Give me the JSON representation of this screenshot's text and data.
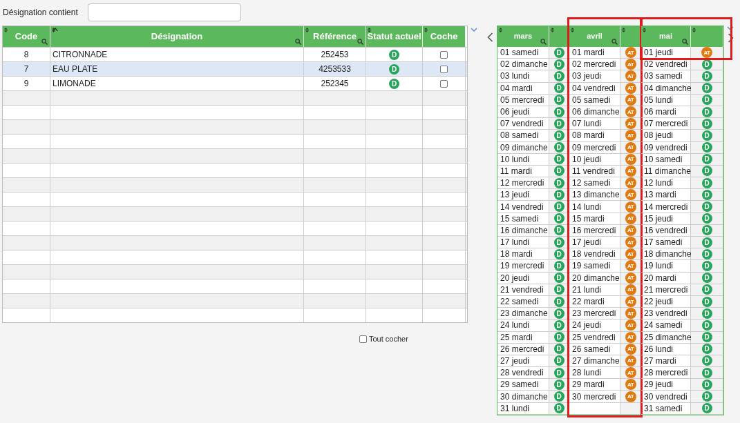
{
  "filter": {
    "label": "Désignation contient"
  },
  "products": {
    "columns": [
      {
        "label": "Code",
        "searchable": true,
        "sorted": false
      },
      {
        "label": "Désignation",
        "searchable": true,
        "sorted": true
      },
      {
        "label": "Référence",
        "searchable": true,
        "sorted": false
      },
      {
        "label": "Statut actuel",
        "searchable": false,
        "sorted": false
      },
      {
        "label": "Coche",
        "searchable": false,
        "sorted": false
      }
    ],
    "rows": [
      {
        "code": "8",
        "designation": "CITRONNADE",
        "reference": "252453",
        "status": "D",
        "color": "#27a55a",
        "checked": false,
        "selected": false
      },
      {
        "code": "7",
        "designation": "EAU PLATE",
        "reference": "4253533",
        "status": "D",
        "color": "#27a55a",
        "checked": false,
        "selected": true
      },
      {
        "code": "9",
        "designation": "LIMONADE",
        "reference": "252345",
        "status": "D",
        "color": "#27a55a",
        "checked": false,
        "selected": false
      }
    ]
  },
  "check_all": {
    "label": "Tout cocher",
    "checked": false
  },
  "calendar": {
    "months": [
      {
        "name": "mars",
        "days": [
          {
            "day": "01 samedi",
            "badge": "D",
            "color": "#27a55a"
          },
          {
            "day": "02 dimanche",
            "badge": "D",
            "color": "#27a55a"
          },
          {
            "day": "03 lundi",
            "badge": "D",
            "color": "#27a55a"
          },
          {
            "day": "04 mardi",
            "badge": "D",
            "color": "#27a55a"
          },
          {
            "day": "05 mercredi",
            "badge": "D",
            "color": "#27a55a"
          },
          {
            "day": "06 jeudi",
            "badge": "D",
            "color": "#27a55a"
          },
          {
            "day": "07 vendredi",
            "badge": "D",
            "color": "#27a55a"
          },
          {
            "day": "08 samedi",
            "badge": "D",
            "color": "#27a55a"
          },
          {
            "day": "09 dimanche",
            "badge": "D",
            "color": "#27a55a"
          },
          {
            "day": "10 lundi",
            "badge": "D",
            "color": "#27a55a"
          },
          {
            "day": "11 mardi",
            "badge": "D",
            "color": "#27a55a"
          },
          {
            "day": "12 mercredi",
            "badge": "D",
            "color": "#27a55a"
          },
          {
            "day": "13 jeudi",
            "badge": "D",
            "color": "#27a55a"
          },
          {
            "day": "14 vendredi",
            "badge": "D",
            "color": "#27a55a"
          },
          {
            "day": "15 samedi",
            "badge": "D",
            "color": "#27a55a"
          },
          {
            "day": "16 dimanche",
            "badge": "D",
            "color": "#27a55a"
          },
          {
            "day": "17 lundi",
            "badge": "D",
            "color": "#27a55a"
          },
          {
            "day": "18 mardi",
            "badge": "D",
            "color": "#27a55a"
          },
          {
            "day": "19 mercredi",
            "badge": "D",
            "color": "#27a55a"
          },
          {
            "day": "20 jeudi",
            "badge": "D",
            "color": "#27a55a"
          },
          {
            "day": "21 vendredi",
            "badge": "D",
            "color": "#27a55a"
          },
          {
            "day": "22 samedi",
            "badge": "D",
            "color": "#27a55a"
          },
          {
            "day": "23 dimanche",
            "badge": "D",
            "color": "#27a55a"
          },
          {
            "day": "24 lundi",
            "badge": "D",
            "color": "#27a55a"
          },
          {
            "day": "25 mardi",
            "badge": "D",
            "color": "#27a55a"
          },
          {
            "day": "26 mercredi",
            "badge": "D",
            "color": "#27a55a"
          },
          {
            "day": "27 jeudi",
            "badge": "D",
            "color": "#27a55a"
          },
          {
            "day": "28 vendredi",
            "badge": "D",
            "color": "#27a55a"
          },
          {
            "day": "29 samedi",
            "badge": "D",
            "color": "#27a55a"
          },
          {
            "day": "30 dimanche",
            "badge": "D",
            "color": "#27a55a"
          },
          {
            "day": "31 lundi",
            "badge": "D",
            "color": "#27a55a"
          }
        ]
      },
      {
        "name": "avril",
        "column_framed": true,
        "days": [
          {
            "day": "01 mardi",
            "badge": "AT",
            "color": "#df7a12"
          },
          {
            "day": "02 mercredi",
            "badge": "AT",
            "color": "#df7a12"
          },
          {
            "day": "03 jeudi",
            "badge": "AT",
            "color": "#df7a12"
          },
          {
            "day": "04 vendredi",
            "badge": "AT",
            "color": "#df7a12"
          },
          {
            "day": "05 samedi",
            "badge": "AT",
            "color": "#df7a12"
          },
          {
            "day": "06 dimanche",
            "badge": "AT",
            "color": "#df7a12"
          },
          {
            "day": "07 lundi",
            "badge": "AT",
            "color": "#df7a12"
          },
          {
            "day": "08 mardi",
            "badge": "AT",
            "color": "#df7a12"
          },
          {
            "day": "09 mercredi",
            "badge": "AT",
            "color": "#df7a12"
          },
          {
            "day": "10 jeudi",
            "badge": "AT",
            "color": "#df7a12"
          },
          {
            "day": "11 vendredi",
            "badge": "AT",
            "color": "#df7a12"
          },
          {
            "day": "12 samedi",
            "badge": "AT",
            "color": "#df7a12"
          },
          {
            "day": "13 dimanche",
            "badge": "AT",
            "color": "#df7a12"
          },
          {
            "day": "14 lundi",
            "badge": "AT",
            "color": "#df7a12"
          },
          {
            "day": "15 mardi",
            "badge": "AT",
            "color": "#df7a12"
          },
          {
            "day": "16 mercredi",
            "badge": "AT",
            "color": "#df7a12"
          },
          {
            "day": "17 jeudi",
            "badge": "AT",
            "color": "#df7a12"
          },
          {
            "day": "18 vendredi",
            "badge": "AT",
            "color": "#df7a12"
          },
          {
            "day": "19 samedi",
            "badge": "AT",
            "color": "#df7a12"
          },
          {
            "day": "20 dimanche",
            "badge": "AT",
            "color": "#df7a12"
          },
          {
            "day": "21 lundi",
            "badge": "AT",
            "color": "#df7a12"
          },
          {
            "day": "22 mardi",
            "badge": "AT",
            "color": "#df7a12"
          },
          {
            "day": "23 mercredi",
            "badge": "AT",
            "color": "#df7a12"
          },
          {
            "day": "24 jeudi",
            "badge": "AT",
            "color": "#df7a12"
          },
          {
            "day": "25 vendredi",
            "badge": "AT",
            "color": "#df7a12"
          },
          {
            "day": "26 samedi",
            "badge": "AT",
            "color": "#df7a12"
          },
          {
            "day": "27 dimanche",
            "badge": "AT",
            "color": "#df7a12"
          },
          {
            "day": "28 lundi",
            "badge": "AT",
            "color": "#df7a12"
          },
          {
            "day": "29 mardi",
            "badge": "AT",
            "color": "#df7a12"
          },
          {
            "day": "30 mercredi",
            "badge": "AT",
            "color": "#df7a12"
          }
        ]
      },
      {
        "name": "mai",
        "first_row_framed": true,
        "days": [
          {
            "day": "01 jeudi",
            "badge": "AT",
            "color": "#df7a12"
          },
          {
            "day": "02 vendredi",
            "badge": "D",
            "color": "#27a55a"
          },
          {
            "day": "03 samedi",
            "badge": "D",
            "color": "#27a55a"
          },
          {
            "day": "04 dimanche",
            "badge": "D",
            "color": "#27a55a"
          },
          {
            "day": "05 lundi",
            "badge": "D",
            "color": "#27a55a"
          },
          {
            "day": "06 mardi",
            "badge": "D",
            "color": "#27a55a"
          },
          {
            "day": "07 mercredi",
            "badge": "D",
            "color": "#27a55a"
          },
          {
            "day": "08 jeudi",
            "badge": "D",
            "color": "#27a55a"
          },
          {
            "day": "09 vendredi",
            "badge": "D",
            "color": "#27a55a"
          },
          {
            "day": "10 samedi",
            "badge": "D",
            "color": "#27a55a"
          },
          {
            "day": "11 dimanche",
            "badge": "D",
            "color": "#27a55a"
          },
          {
            "day": "12 lundi",
            "badge": "D",
            "color": "#27a55a"
          },
          {
            "day": "13 mardi",
            "badge": "D",
            "color": "#27a55a"
          },
          {
            "day": "14 mercredi",
            "badge": "D",
            "color": "#27a55a"
          },
          {
            "day": "15 jeudi",
            "badge": "D",
            "color": "#27a55a"
          },
          {
            "day": "16 vendredi",
            "badge": "D",
            "color": "#27a55a"
          },
          {
            "day": "17 samedi",
            "badge": "D",
            "color": "#27a55a"
          },
          {
            "day": "18 dimanche",
            "badge": "D",
            "color": "#27a55a"
          },
          {
            "day": "19 lundi",
            "badge": "D",
            "color": "#27a55a"
          },
          {
            "day": "20 mardi",
            "badge": "D",
            "color": "#27a55a"
          },
          {
            "day": "21 mercredi",
            "badge": "D",
            "color": "#27a55a"
          },
          {
            "day": "22 jeudi",
            "badge": "D",
            "color": "#27a55a"
          },
          {
            "day": "23 vendredi",
            "badge": "D",
            "color": "#27a55a"
          },
          {
            "day": "24 samedi",
            "badge": "D",
            "color": "#27a55a"
          },
          {
            "day": "25 dimanche",
            "badge": "D",
            "color": "#27a55a"
          },
          {
            "day": "26 lundi",
            "badge": "D",
            "color": "#27a55a"
          },
          {
            "day": "27 mardi",
            "badge": "D",
            "color": "#27a55a"
          },
          {
            "day": "28 mercredi",
            "badge": "D",
            "color": "#27a55a"
          },
          {
            "day": "29 jeudi",
            "badge": "D",
            "color": "#27a55a"
          },
          {
            "day": "30 vendredi",
            "badge": "D",
            "color": "#27a55a"
          },
          {
            "day": "31 samedi",
            "badge": "D",
            "color": "#27a55a"
          }
        ]
      }
    ]
  }
}
